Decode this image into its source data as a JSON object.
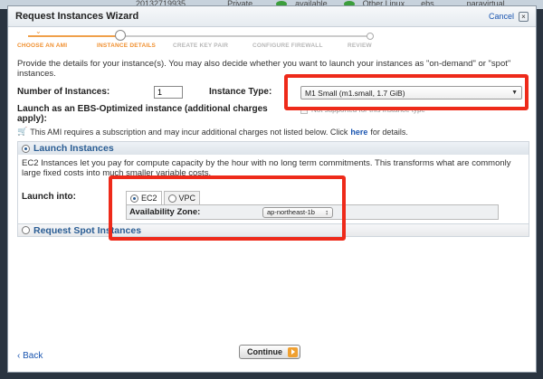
{
  "background": {
    "cells": [
      "20132719935",
      "Private",
      "available",
      "Other Linux",
      "ebs",
      "paravirtual"
    ]
  },
  "modal": {
    "title": "Request Instances Wizard",
    "cancel_label": "Cancel",
    "close_label": "×"
  },
  "steps": [
    {
      "label": "CHOOSE AN AMI",
      "state": "done"
    },
    {
      "label": "INSTANCE DETAILS",
      "state": "current"
    },
    {
      "label": "CREATE KEY PAIR",
      "state": "todo"
    },
    {
      "label": "CONFIGURE FIREWALL",
      "state": "todo"
    },
    {
      "label": "REVIEW",
      "state": "todo"
    }
  ],
  "form": {
    "description": "Provide the details for your instance(s). You may also decide whether you want to launch your instances as \"on-demand\" or \"spot\" instances.",
    "num_instances_label": "Number of Instances:",
    "num_instances_value": "1",
    "instance_type_label": "Instance Type:",
    "instance_type_value": "M1 Small (m1.small, 1.7 GiB)",
    "ebs_label": "Launch as an EBS-Optimized instance (additional charges apply):",
    "ebs_note": "Not supported for this instance type",
    "subscription_note": "This AMI requires a subscription and may incur additional charges not listed below. Click",
    "here_link": "here",
    "subscription_tail": "for details."
  },
  "launch_panel": {
    "title": "Launch Instances",
    "description": "EC2 Instances let you pay for compute capacity by the hour with no long term commitments. This transforms what are commonly large fixed costs into much smaller variable costs.",
    "launch_into_label": "Launch into:",
    "tab_ec2": "EC2",
    "tab_vpc": "VPC",
    "az_label": "Availability Zone:",
    "az_value": "ap-northeast-1b"
  },
  "spot_panel": {
    "title": "Request Spot Instances"
  },
  "footer": {
    "back_label": "Back",
    "continue_label": "Continue"
  },
  "colors": {
    "accent_orange": "#f09030",
    "link_blue": "#1a55b0",
    "annotation_red": "#ee2a1a"
  }
}
